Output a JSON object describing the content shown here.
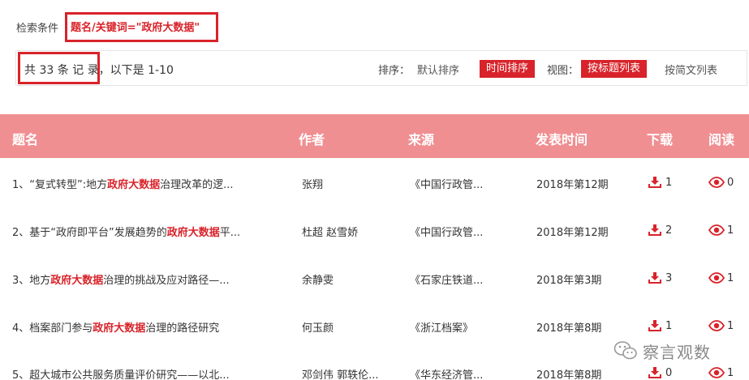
{
  "criteria": {
    "label": "检索条件",
    "value": "题名/关键词=\"政府大数据\""
  },
  "results": {
    "count_text": "共 33 条 记 录",
    "range_text": "，以下是 1-10"
  },
  "sort": {
    "label": "排序：",
    "default": "默认排序",
    "time": "时间排序"
  },
  "view": {
    "label": "视图：",
    "title_list": "按标题列表",
    "brief_list": "按简文列表"
  },
  "table": {
    "headers": {
      "title": "题名",
      "author": "作者",
      "source": "来源",
      "date": "发表时间",
      "download": "下载",
      "read": "阅读"
    },
    "rows": [
      {
        "pre": "1、“复式转型”:地方",
        "kw": "政府大数据",
        "post": "治理改革的逻...",
        "author": "张翔",
        "source": "《中国行政管...",
        "date": "2018年第12期",
        "download": "1",
        "read": "0"
      },
      {
        "pre": "2、基于“政府即平台”发展趋势的",
        "kw": "政府大数据",
        "post": "平...",
        "author": "杜超 赵雪娇",
        "source": "《中国行政管...",
        "date": "2018年第12期",
        "download": "2",
        "read": "1"
      },
      {
        "pre": "3、地方",
        "kw": "政府大数据",
        "post": "治理的挑战及应对路径—...",
        "author": "余静雯",
        "source": "《石家庄铁道...",
        "date": "2018年第3期",
        "download": "3",
        "read": "1"
      },
      {
        "pre": "4、档案部门参与",
        "kw": "政府大数据",
        "post": "治理的路径研究",
        "author": "何玉颜",
        "source": "《浙江档案》",
        "date": "2018年第8期",
        "download": "1",
        "read": "1"
      },
      {
        "pre": "5、超大城市公共服务质量评价研究——以北...",
        "kw": "",
        "post": "",
        "author": "邓剑伟 郭轶伦...",
        "source": "《华东经济管...",
        "date": "2018年第8期",
        "download": "0",
        "read": "1"
      }
    ]
  },
  "watermark": {
    "text": "察言观数"
  },
  "colors": {
    "accent": "#d8232a",
    "header_bg": "#f08f92"
  }
}
